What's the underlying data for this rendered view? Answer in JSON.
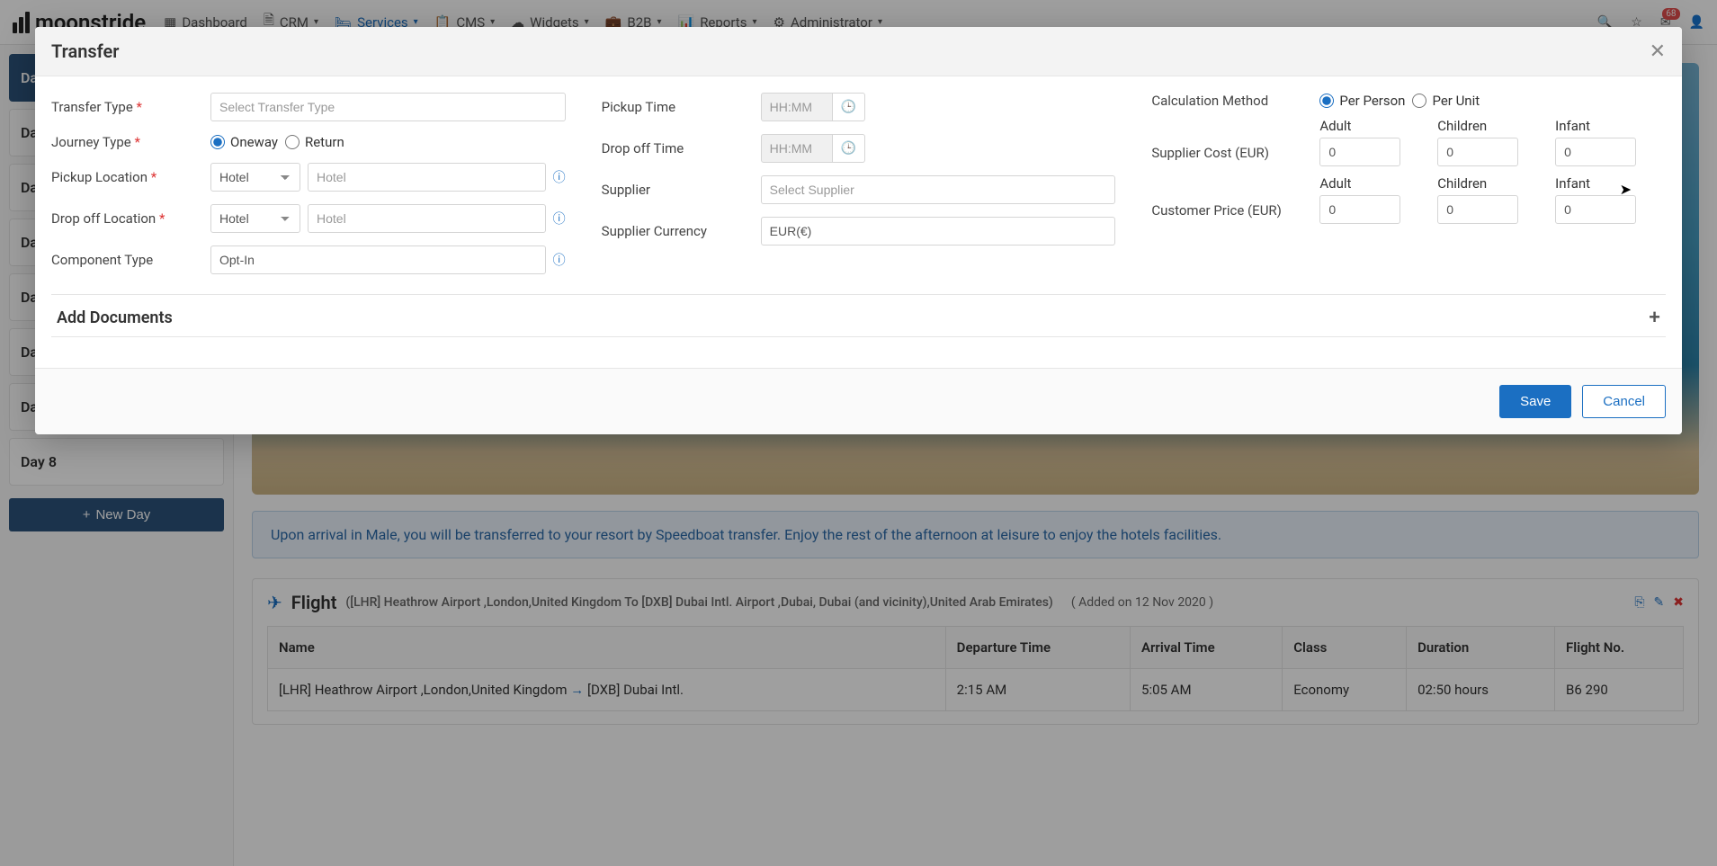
{
  "nav": {
    "brand": "moonstride",
    "items": [
      "Dashboard",
      "CRM",
      "Services",
      "CMS",
      "Widgets",
      "B2B",
      "Reports",
      "Administrator"
    ],
    "active_index": 2,
    "notif_count": "68"
  },
  "sidebar": {
    "days": [
      "Da",
      "Da",
      "Da",
      "Da",
      "Da",
      "Da",
      "Da",
      "Day 8"
    ],
    "new_day": "New Day"
  },
  "main": {
    "banner": "Upon arrival in Male, you will be transferred to your resort by Speedboat transfer. Enjoy the rest of the afternoon at leisure to enjoy the hotels facilities.",
    "flight": {
      "title": "Flight",
      "route": "([LHR] Heathrow Airport ,London,United Kingdom To [DXB] Dubai Intl. Airport ,Dubai, Dubai (and vicinity),United Arab Emirates)",
      "added": "( Added on 12 Nov 2020 )",
      "columns": [
        "Name",
        "Departure Time",
        "Arrival Time",
        "Class",
        "Duration",
        "Flight No."
      ],
      "row": {
        "name_from": "[LHR] Heathrow Airport ,London,United Kingdom",
        "name_to": "[DXB] Dubai Intl.",
        "dep": "2:15 AM",
        "arr": "5:05 AM",
        "class": "Economy",
        "dur": "02:50 hours",
        "no": "B6 290"
      }
    }
  },
  "modal": {
    "title": "Transfer",
    "labels": {
      "transfer_type": "Transfer Type",
      "journey_type": "Journey Type",
      "pickup_loc": "Pickup Location",
      "dropoff_loc": "Drop off Location",
      "component_type": "Component Type",
      "pickup_time": "Pickup Time",
      "dropoff_time": "Drop off Time",
      "supplier": "Supplier",
      "supplier_currency": "Supplier Currency",
      "calc_method": "Calculation Method",
      "supplier_cost": "Supplier Cost (EUR)",
      "customer_price": "Customer Price (EUR)",
      "add_docs": "Add Documents"
    },
    "placeholders": {
      "transfer_type": "Select Transfer Type",
      "hotel": "Hotel",
      "time": "HH:MM",
      "supplier": "Select Supplier"
    },
    "options": {
      "journey": [
        "Oneway",
        "Return"
      ],
      "loc_type": "Hotel",
      "component": "Opt-In",
      "currency": "EUR(€)",
      "calc": [
        "Per Person",
        "Per Unit"
      ]
    },
    "price_heads": [
      "Adult",
      "Children",
      "Infant"
    ],
    "price_val": "0",
    "buttons": {
      "save": "Save",
      "cancel": "Cancel"
    }
  }
}
